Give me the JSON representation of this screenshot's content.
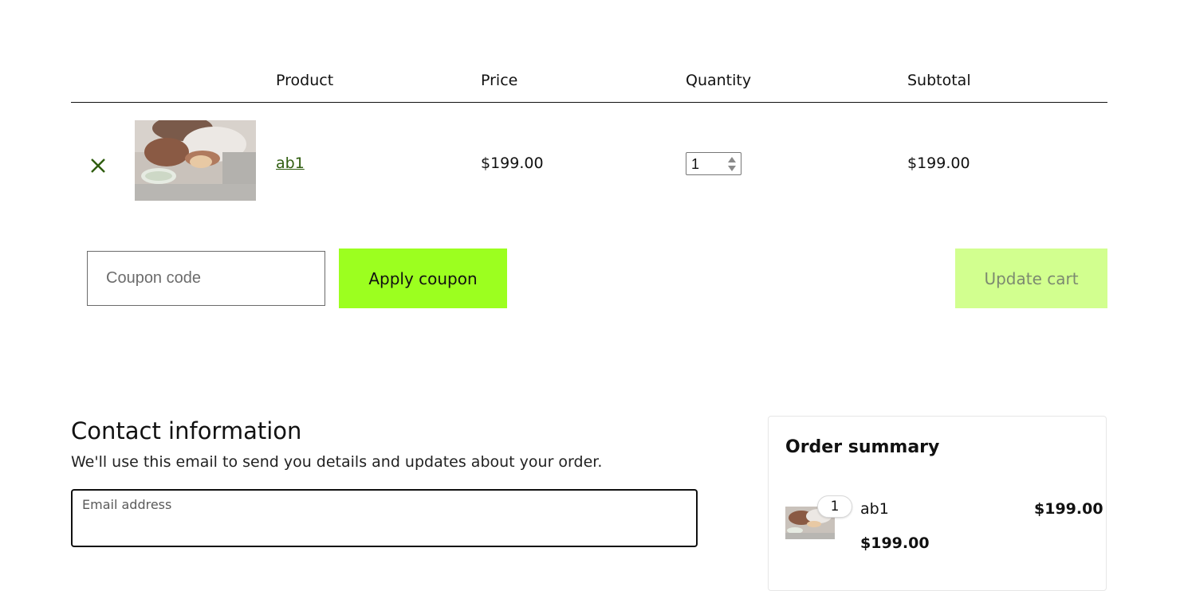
{
  "table": {
    "headers": {
      "product": "Product",
      "price": "Price",
      "quantity": "Quantity",
      "subtotal": "Subtotal"
    },
    "rows": [
      {
        "remove_icon": "close-icon",
        "name": "ab1",
        "price": "$199.00",
        "quantity": "1",
        "subtotal": "$199.00"
      }
    ]
  },
  "coupon": {
    "placeholder": "Coupon code",
    "apply_label": "Apply coupon"
  },
  "update_cart_label": "Update cart",
  "contact": {
    "title": "Contact information",
    "description": "We'll use this email to send you details and updates about your order.",
    "email_label": "Email address"
  },
  "order_summary": {
    "title": "Order summary",
    "items": [
      {
        "quantity": "1",
        "name": "ab1",
        "total": "$199.00",
        "unit_price": "$199.00"
      }
    ]
  },
  "colors": {
    "accent": "#9cff1f",
    "accent_light": "#d2ff8f",
    "link": "#2f5d0f"
  }
}
